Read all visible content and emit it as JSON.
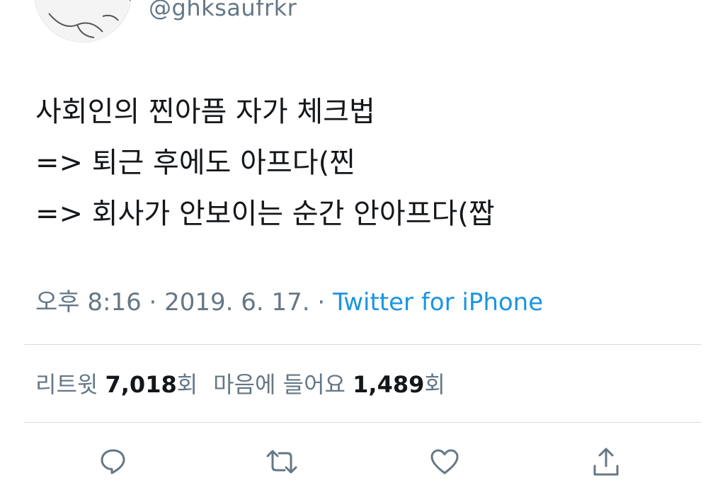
{
  "user": {
    "handle": "@ghksaufrkr"
  },
  "tweet": {
    "lines": [
      "사회인의 찐아픔 자가 체크법",
      "=> 퇴근 후에도 아프다(찐",
      "=> 회사가 안보이는 순간 안아프다(짭"
    ]
  },
  "meta": {
    "time": "오후 8:16",
    "separator1": " · ",
    "date": "2019. 6. 17.",
    "separator2": " · ",
    "source": "Twitter for iPhone"
  },
  "stats": {
    "retweets_label": "리트윗 ",
    "retweets_count": "7,018",
    "retweets_suffix": "회",
    "likes_label": "마음에 들어요 ",
    "likes_count": "1,489",
    "likes_suffix": "회"
  },
  "actions": [
    {
      "name": "reply",
      "icon": "speech-bubble-icon"
    },
    {
      "name": "retweet",
      "icon": "retweet-icon"
    },
    {
      "name": "like",
      "icon": "heart-icon"
    },
    {
      "name": "share",
      "icon": "share-icon"
    }
  ],
  "colors": {
    "text": "#14171a",
    "secondary": "#657786",
    "link": "#1b95e0",
    "divider": "#d8dde1"
  }
}
